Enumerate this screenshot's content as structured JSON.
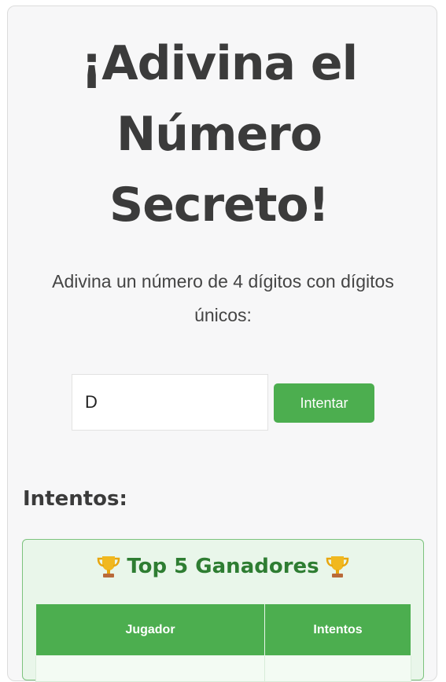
{
  "game": {
    "title": "¡Adivina el Número Secreto!",
    "instructions": "Adivina un número de 4 dígitos con dígitos únicos:",
    "guess_input_value": "D",
    "try_button_label": "Intentar",
    "attempts_heading": "Intentos:"
  },
  "leaderboard": {
    "title": "Top 5 Ganadores",
    "icon": "trophy-icon",
    "columns": [
      "Jugador",
      "Intentos"
    ]
  },
  "colors": {
    "accent_green": "#4cae4f",
    "heading_green": "#2e7d32",
    "text_dark": "#3b3b3b"
  }
}
